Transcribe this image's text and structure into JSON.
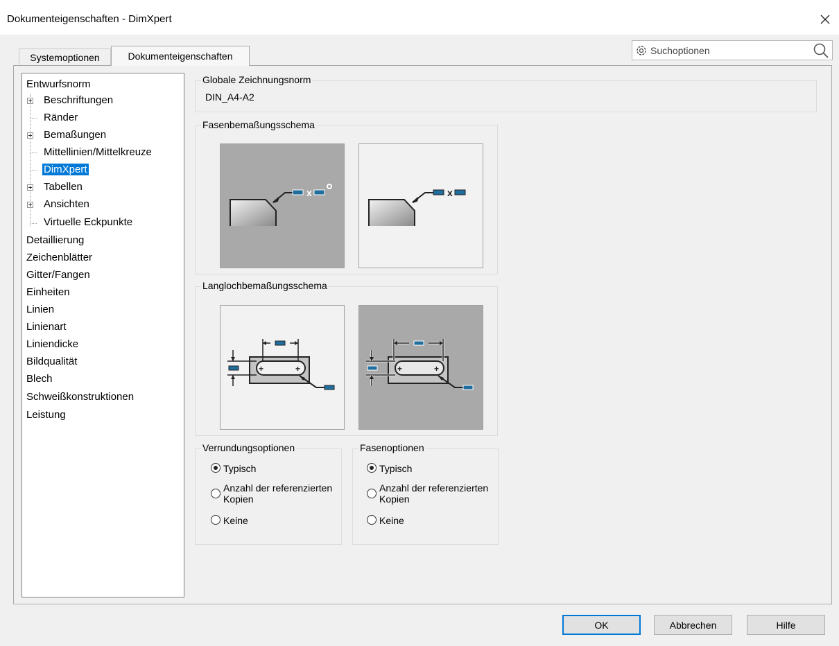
{
  "window": {
    "title": "Dokumenteigenschaften - DimXpert"
  },
  "tabs": [
    {
      "label": "Systemoptionen",
      "active": false
    },
    {
      "label": "Dokumenteigenschaften",
      "active": true
    }
  ],
  "search": {
    "placeholder": "Suchoptionen"
  },
  "tree": {
    "items": [
      {
        "label": "Entwurfsnorm",
        "expandable": false
      },
      {
        "label": "Beschriftungen",
        "expandable": true
      },
      {
        "label": "Ränder",
        "expandable": false
      },
      {
        "label": "Bemaßungen",
        "expandable": true
      },
      {
        "label": "Mittellinien/Mittelkreuze",
        "expandable": false
      },
      {
        "label": "DimXpert",
        "expandable": false,
        "selected": true
      },
      {
        "label": "Tabellen",
        "expandable": true
      },
      {
        "label": "Ansichten",
        "expandable": true
      },
      {
        "label": "Virtuelle Eckpunkte",
        "expandable": false
      },
      {
        "label": "Detaillierung",
        "expandable": false
      },
      {
        "label": "Zeichenblätter",
        "expandable": false
      },
      {
        "label": "Gitter/Fangen",
        "expandable": false
      },
      {
        "label": "Einheiten",
        "expandable": false
      },
      {
        "label": "Linien",
        "expandable": false
      },
      {
        "label": "Linienart",
        "expandable": false
      },
      {
        "label": "Liniendicke",
        "expandable": false
      },
      {
        "label": "Bildqualität",
        "expandable": false
      },
      {
        "label": "Blech",
        "expandable": false
      },
      {
        "label": "Schweißkonstruktionen",
        "expandable": false
      },
      {
        "label": "Leistung",
        "expandable": false
      }
    ]
  },
  "global_norm": {
    "title": "Globale Zeichnungsnorm",
    "value": "DIN_A4-A2"
  },
  "chamfer_scheme": {
    "title": "Fasenbemaßungsschema",
    "selected_index": 0
  },
  "slot_scheme": {
    "title": "Langlochbemaßungsschema",
    "selected_index": 1
  },
  "fillet_options": {
    "title": "Verrundungsoptionen",
    "options": [
      "Typisch",
      "Anzahl der referenzierten Kopien",
      "Keine"
    ],
    "selected": "Typisch"
  },
  "chamfer_options": {
    "title": "Fasenoptionen",
    "options": [
      "Typisch",
      "Anzahl der referenzierten Kopien",
      "Keine"
    ],
    "selected": "Typisch"
  },
  "buttons": {
    "ok": "OK",
    "cancel": "Abbrechen",
    "help": "Hilfe"
  },
  "colors": {
    "accent": "#0078d7",
    "dim_box": "#1f6e9e",
    "selected_bg": "#a9a9a9"
  }
}
